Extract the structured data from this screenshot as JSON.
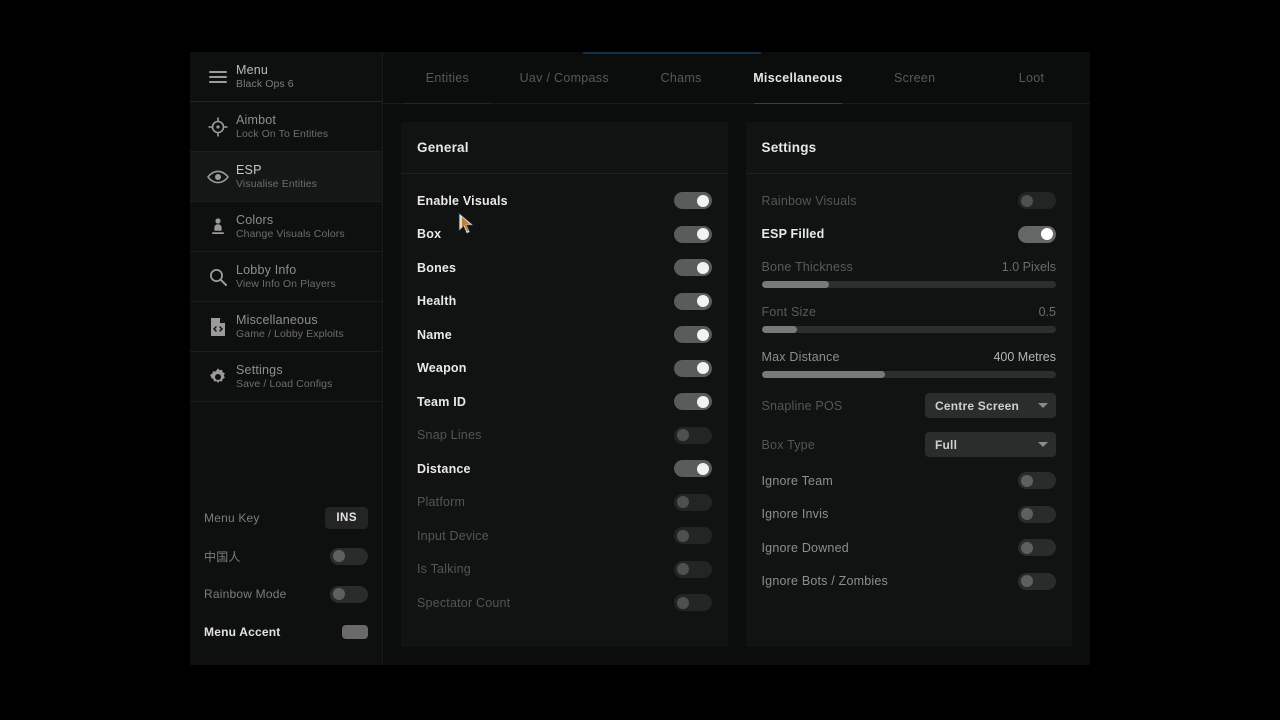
{
  "theme": {
    "page_bg": "#000000",
    "window_bg": "#0d0f0e",
    "panel_bg": "#111312",
    "accent": "#13324a",
    "text_bright": "#e9e9e9",
    "text_dim": "#545655",
    "toggle_on": "#5a5c5b",
    "toggle_off": "#2a2c2b",
    "slider_fill": "#77797a"
  },
  "sidebar": {
    "brand": {
      "title": "Menu",
      "subtitle": "Black Ops 6",
      "icon": "hamburger-icon"
    },
    "items": [
      {
        "title": "Aimbot",
        "subtitle": "Lock On To Entities",
        "icon": "crosshair-icon",
        "active": false
      },
      {
        "title": "ESP",
        "subtitle": "Visualise Entities",
        "icon": "eye-icon",
        "active": true
      },
      {
        "title": "Colors",
        "subtitle": "Change Visuals Colors",
        "icon": "person-icon",
        "active": false
      },
      {
        "title": "Lobby Info",
        "subtitle": "View Info On Players",
        "icon": "magnifier-icon",
        "active": false
      },
      {
        "title": "Miscellaneous",
        "subtitle": "Game / Lobby Exploits",
        "icon": "code-file-icon",
        "active": false
      },
      {
        "title": "Settings",
        "subtitle": "Save / Load Configs",
        "icon": "gear-icon",
        "active": false
      }
    ],
    "footer": [
      {
        "label": "Menu Key",
        "control": "key",
        "value": "INS"
      },
      {
        "label": "中国人",
        "control": "toggle",
        "value": "off"
      },
      {
        "label": "Rainbow Mode",
        "control": "toggle",
        "value": "off"
      },
      {
        "label": "Menu Accent",
        "control": "swatch",
        "value": "#6a6a6a",
        "highlighted": true
      }
    ]
  },
  "tabs": [
    {
      "label": "Entities",
      "active": false
    },
    {
      "label": "Uav / Compass",
      "active": false
    },
    {
      "label": "Chams",
      "active": false
    },
    {
      "label": "Miscellaneous",
      "active": true
    },
    {
      "label": "Screen",
      "active": false
    },
    {
      "label": "Loot",
      "active": false
    }
  ],
  "general_panel": {
    "title": "General",
    "options": [
      {
        "label": "Enable Visuals",
        "state": "on",
        "emphasis": "lit"
      },
      {
        "label": "Box",
        "state": "on",
        "emphasis": "lit"
      },
      {
        "label": "Bones",
        "state": "on",
        "emphasis": "lit"
      },
      {
        "label": "Health",
        "state": "on",
        "emphasis": "lit"
      },
      {
        "label": "Name",
        "state": "on",
        "emphasis": "lit"
      },
      {
        "label": "Weapon",
        "state": "on",
        "emphasis": "lit"
      },
      {
        "label": "Team ID",
        "state": "on",
        "emphasis": "lit"
      },
      {
        "label": "Snap Lines",
        "state": "off",
        "emphasis": "dim"
      },
      {
        "label": "Distance",
        "state": "on",
        "emphasis": "lit"
      },
      {
        "label": "Platform",
        "state": "off",
        "emphasis": "dim"
      },
      {
        "label": "Input Device",
        "state": "off",
        "emphasis": "dim"
      },
      {
        "label": "Is Talking",
        "state": "off",
        "emphasis": "dim"
      },
      {
        "label": "Spectator Count",
        "state": "off",
        "emphasis": "dim"
      }
    ]
  },
  "settings_panel": {
    "title": "Settings",
    "toggles_top": [
      {
        "label": "Rainbow Visuals",
        "state": "off",
        "emphasis": "dim"
      },
      {
        "label": "ESP Filled",
        "state": "on",
        "emphasis": "lit"
      }
    ],
    "sliders": [
      {
        "label": "Bone Thickness",
        "value_text": "1.0 Pixels",
        "percent": 23
      },
      {
        "label": "Font Size",
        "value_text": "0.5",
        "percent": 12
      },
      {
        "label": "Max Distance",
        "value_text": "400 Metres",
        "percent": 42,
        "emphasis": "mid"
      }
    ],
    "dropdowns": [
      {
        "label": "Snapline POS",
        "value": "Centre Screen"
      },
      {
        "label": "Box Type",
        "value": "Full"
      }
    ],
    "toggles_bottom": [
      {
        "label": "Ignore Team",
        "state": "off",
        "emphasis": "mid"
      },
      {
        "label": "Ignore Invis",
        "state": "off",
        "emphasis": "mid"
      },
      {
        "label": "Ignore Downed",
        "state": "off",
        "emphasis": "mid"
      },
      {
        "label": "Ignore Bots / Zombies",
        "state": "off",
        "emphasis": "mid"
      }
    ]
  }
}
